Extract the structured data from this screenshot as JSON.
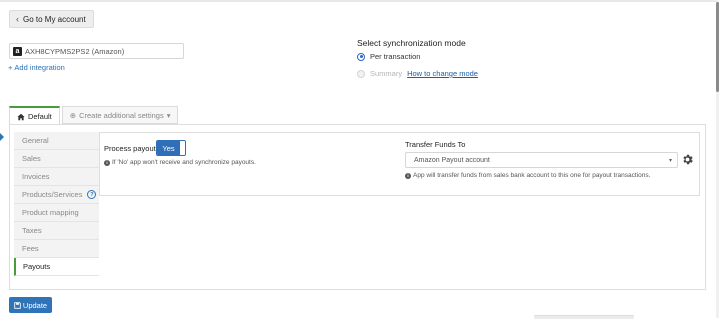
{
  "nav": {
    "back_label": "Go to My account"
  },
  "integration": {
    "name": "AXH8CYPMS2PS2 (Amazon)",
    "add_label": "Add integration"
  },
  "sync": {
    "title": "Select synchronization mode",
    "options": [
      {
        "label": "Per transaction",
        "selected": true
      },
      {
        "label": "Summary",
        "selected": false,
        "disabled": true,
        "link": "How to change mode"
      }
    ]
  },
  "tabs": [
    {
      "label": "Default",
      "active": true
    },
    {
      "label": "Create additional settings",
      "active": false
    }
  ],
  "menu": {
    "items": [
      {
        "label": "General"
      },
      {
        "label": "Sales"
      },
      {
        "label": "Invoices"
      },
      {
        "label": "Products/Services"
      },
      {
        "label": "Product mapping"
      },
      {
        "label": "Taxes"
      },
      {
        "label": "Fees"
      },
      {
        "label": "Payouts",
        "active": true
      }
    ]
  },
  "payouts": {
    "process_label": "Process payouts",
    "toggle_value": "Yes",
    "process_info": "If 'No' app won't receive and synchronize payouts.",
    "transfer_label": "Transfer Funds To",
    "transfer_value": "Amazon Payout account",
    "transfer_info": "App will transfer funds from sales bank account to this one for payout transactions."
  },
  "actions": {
    "update_label": "Update"
  },
  "colors": {
    "accent": "#2f73b8",
    "active_tab": "#4a9b3c",
    "link": "#2a74b7"
  }
}
